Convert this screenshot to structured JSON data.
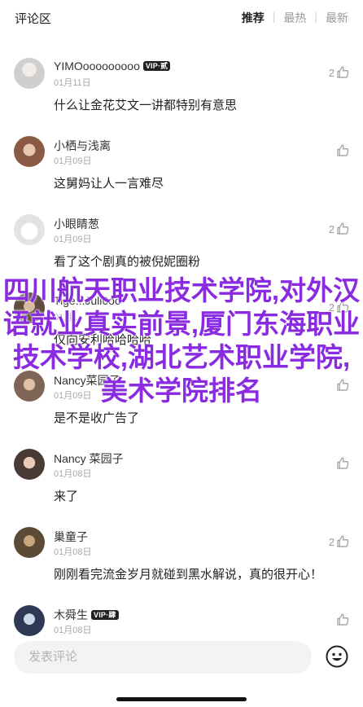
{
  "header": {
    "title": "评论区",
    "tabs": [
      {
        "label": "推荐",
        "active": true
      },
      {
        "label": "最热",
        "active": false
      },
      {
        "label": "最新",
        "active": false
      }
    ]
  },
  "comments": [
    {
      "user": "YIMOooooooooo",
      "vip": "VIP·贰",
      "date": "01月11日",
      "text": "什么让金花艾文一讲都特别有意思",
      "likes": "2",
      "avatar_color": "#cfcfcf"
    },
    {
      "user": "小栖与浅离",
      "vip": "",
      "date": "01月09日",
      "text": "这舅妈让人一言难尽",
      "likes": "",
      "avatar_color": "#a67a62"
    },
    {
      "user": "小眼睛葱",
      "vip": "",
      "date": "01月09日",
      "text": "看了这个剧真的被倪妮圈粉",
      "likes": "2",
      "avatar_color": "#eaeaea"
    },
    {
      "user": "Tige...Juli6oc",
      "vip": "",
      "date": "01月1",
      "text": "仅向安利哈哈哈哈",
      "likes": "2",
      "avatar_color": "#6b5a4a"
    },
    {
      "user": "Nancy菜园子",
      "vip": "",
      "date": "01月09日",
      "text": "是不是收广告了",
      "likes": "",
      "avatar_color": "#9a7a68"
    },
    {
      "user": "Nancy 菜园子",
      "vip": "",
      "date": "01月08日",
      "text": "来了",
      "likes": "",
      "avatar_color": "#6a5a55"
    },
    {
      "user": "巢童子",
      "vip": "",
      "date": "01月08日",
      "text": "刚刚看完流金岁月就碰到黑水解说，真的很开心！",
      "likes": "2",
      "avatar_color": "#6d5c44"
    },
    {
      "user": "木舜生",
      "vip": "VIP·肆",
      "date": "01月08日",
      "text": "",
      "likes": "",
      "avatar_color": "#3a4a6a"
    }
  ],
  "overlay_text": "四川航天职业技术学院,对外汉语就业真实前景,厦门东海职业技术学校,湖北艺术职业学院,美术学院排名",
  "input": {
    "placeholder": "发表评论"
  },
  "icons": {
    "like": "thumbs-up-icon",
    "emoji": "smiley-icon"
  },
  "colors": {
    "overlay": "#8a2be2"
  }
}
